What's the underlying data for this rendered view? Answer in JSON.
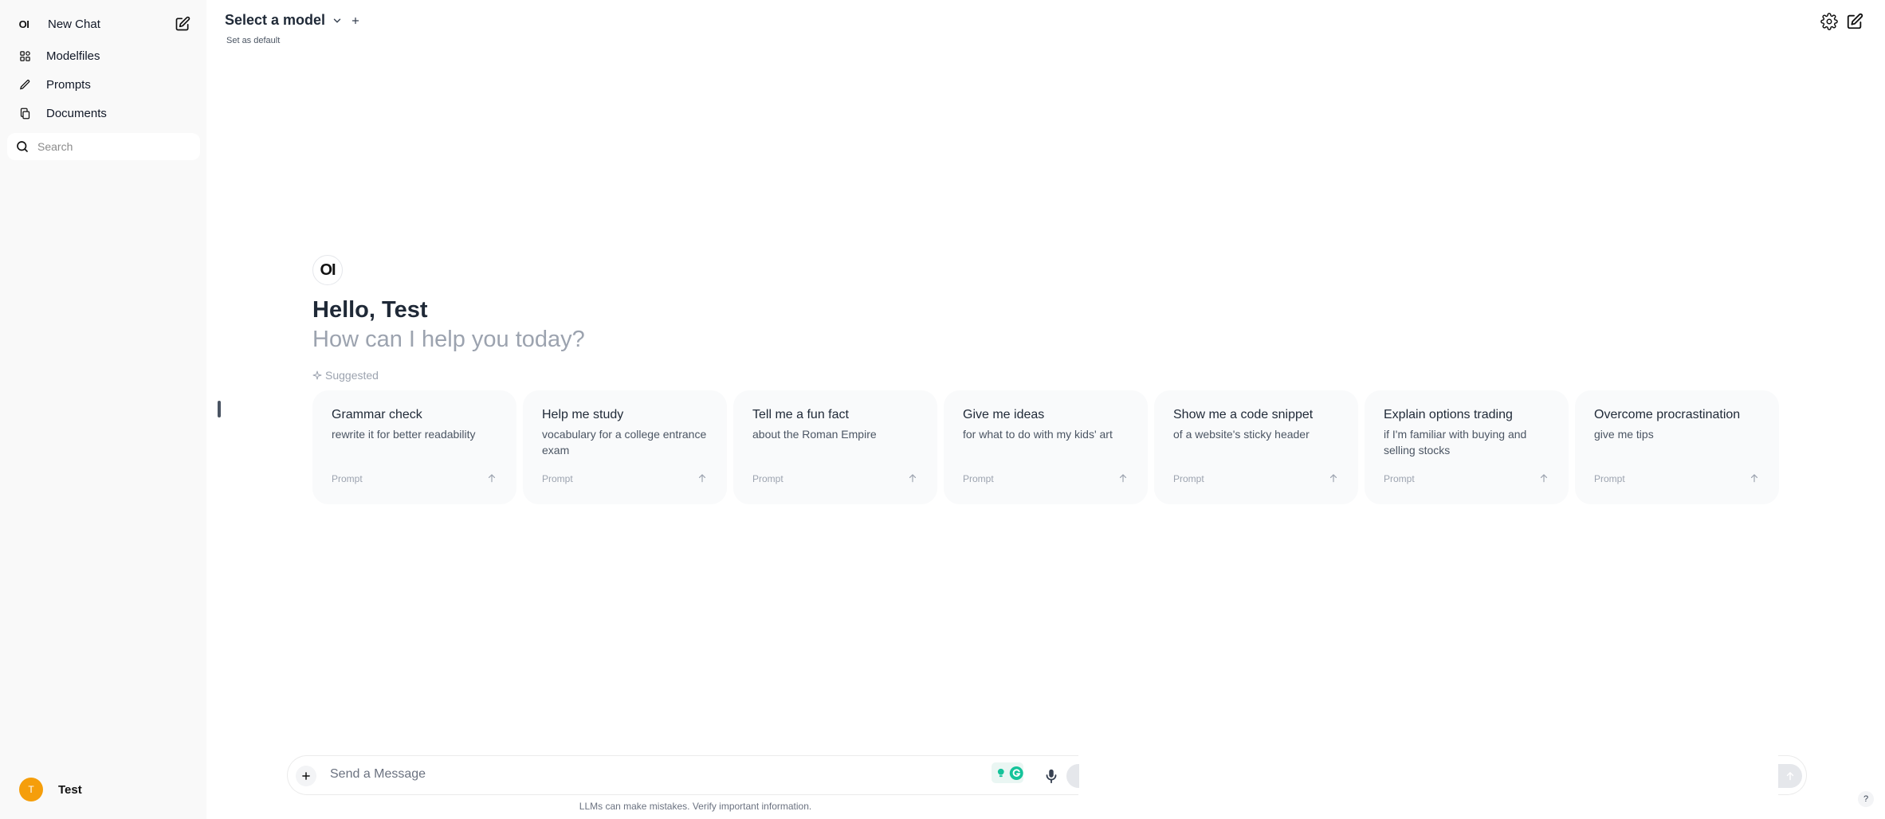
{
  "sidebar": {
    "logo_text": "OI",
    "new_chat_label": "New Chat",
    "items": [
      {
        "label": "Modelfiles",
        "icon": "modelfiles-icon"
      },
      {
        "label": "Prompts",
        "icon": "pencil-icon"
      },
      {
        "label": "Documents",
        "icon": "documents-icon"
      }
    ],
    "search": {
      "placeholder": "Search",
      "value": ""
    },
    "user": {
      "initial": "T",
      "name": "Test",
      "avatar_color": "#f59e0b"
    }
  },
  "header": {
    "model_selector_label": "Select a model",
    "set_default_label": "Set as default"
  },
  "welcome": {
    "logo_text": "OI",
    "greeting": "Hello, Test",
    "subtitle": "How can I help you today?",
    "suggested_label": "Suggested"
  },
  "suggestions": [
    {
      "title": "Grammar check",
      "subtitle": "rewrite it for better readability",
      "tag": "Prompt"
    },
    {
      "title": "Help me study",
      "subtitle": "vocabulary for a college entrance exam",
      "tag": "Prompt"
    },
    {
      "title": "Tell me a fun fact",
      "subtitle": "about the Roman Empire",
      "tag": "Prompt"
    },
    {
      "title": "Give me ideas",
      "subtitle": "for what to do with my kids' art",
      "tag": "Prompt"
    },
    {
      "title": "Show me a code snippet",
      "subtitle": "of a website's sticky header",
      "tag": "Prompt"
    },
    {
      "title": "Explain options trading",
      "subtitle": "if I'm familiar with buying and selling stocks",
      "tag": "Prompt"
    },
    {
      "title": "Overcome procrastination",
      "subtitle": "give me tips",
      "tag": "Prompt"
    }
  ],
  "composer": {
    "placeholder": "Send a Message",
    "value": "",
    "disclaimer": "LLMs can make mistakes. Verify important information."
  },
  "help_label": "?",
  "colors": {
    "accent_avatar": "#f59e0b",
    "sidebar_bg": "#f9f9f9",
    "card_bg": "#f9fafb",
    "grammarly_green": "#15c39a"
  }
}
